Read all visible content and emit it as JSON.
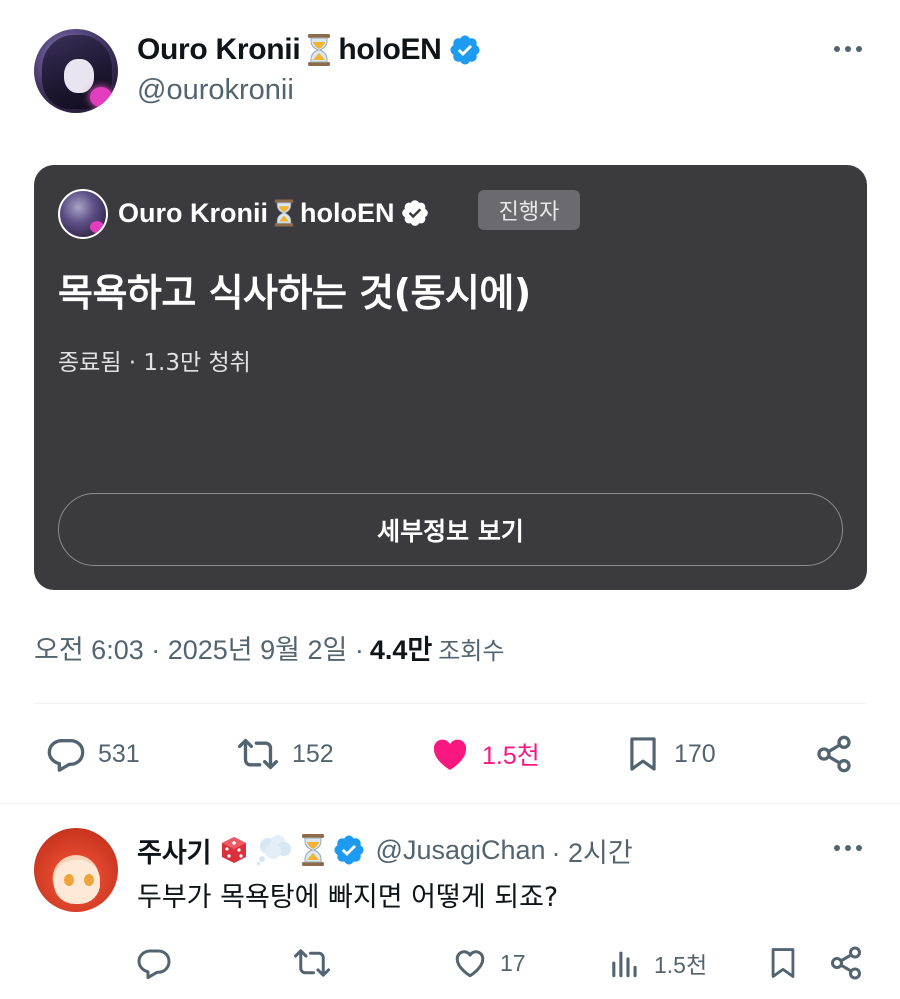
{
  "post": {
    "author": {
      "display_name": "Ouro Kronii",
      "brand": "holoEN",
      "handle": "@ourokronii",
      "verified": true
    },
    "space_card": {
      "host_name": "Ouro Kronii",
      "host_brand": "holoEN",
      "host_badge": "진행자",
      "title": "목욕하고 식사하는 것(동시에)",
      "meta": "종료됨 · 1.3만 청취",
      "details_button": "세부정보 보기"
    },
    "timestamp": "오전 6:03 · 2025년 9월 2일 ·",
    "views_count": "4.4만",
    "views_label": "조회수",
    "actions": {
      "replies": "531",
      "reposts": "152",
      "likes": "1.5천",
      "bookmarks": "170"
    }
  },
  "reply": {
    "display_name": "주사기",
    "handle": "@JusagiChan",
    "time": "· 2시간",
    "text": "두부가 목욕탕에 빠지면 어떻게 되죠?",
    "actions": {
      "replies": "",
      "reposts": "",
      "likes": "17",
      "views": "1.5천"
    }
  },
  "colors": {
    "accent_blue": "#1d9bf0",
    "like_pink": "#f91880",
    "card_bg": "#3a3a3f",
    "muted_text": "#536471"
  },
  "icons": [
    "hourglass-icon",
    "verified-badge-icon",
    "more-icon",
    "reply-icon",
    "repost-icon",
    "like-icon",
    "bookmark-icon",
    "share-icon",
    "views-icon",
    "dice-emoji-icon",
    "thought-bubble-icon"
  ]
}
